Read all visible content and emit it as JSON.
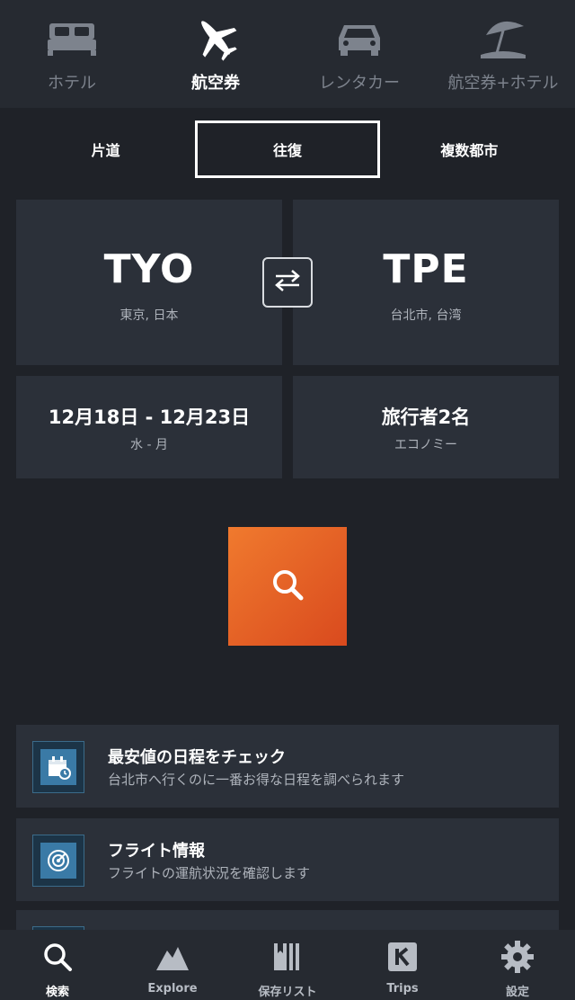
{
  "categories": [
    {
      "label": "ホテル",
      "icon": "bed-icon",
      "active": false
    },
    {
      "label": "航空券",
      "icon": "airplane-icon",
      "active": true
    },
    {
      "label": "レンタカー",
      "icon": "car-icon",
      "active": false
    },
    {
      "label": "航空券+ホテル",
      "icon": "beach-umbrella-icon",
      "active": false
    }
  ],
  "trip_types": [
    {
      "label": "片道",
      "active": false
    },
    {
      "label": "往復",
      "active": true
    },
    {
      "label": "複数都市",
      "active": false
    }
  ],
  "route": {
    "origin_code": "TYO",
    "origin_city": "東京, 日本",
    "dest_code": "TPE",
    "dest_city": "台北市, 台湾",
    "swap_icon": "swap-arrows-icon"
  },
  "dates": {
    "range": "12月18日 - 12月23日",
    "days": "水 - 月"
  },
  "travelers": {
    "count": "旅行者2名",
    "cabin": "エコノミー"
  },
  "search": {
    "icon": "search-icon"
  },
  "info_rows": [
    {
      "title": "最安値の日程をチェック",
      "desc": "台北市へ行くのに一番お得な日程を調べられます",
      "icon": "calendar-clock-icon"
    },
    {
      "title": "フライト情報",
      "desc": "フライトの運航状況を確認します",
      "icon": "radar-icon"
    }
  ],
  "bottom_nav": [
    {
      "label": "検索",
      "icon": "search-icon",
      "active": true
    },
    {
      "label": "Explore",
      "icon": "mountain-icon",
      "active": false
    },
    {
      "label": "保存リスト",
      "icon": "bookmark-list-icon",
      "active": false
    },
    {
      "label": "Trips",
      "icon": "kayak-k-icon",
      "active": false
    },
    {
      "label": "設定",
      "icon": "gear-icon",
      "active": false
    }
  ],
  "colors": {
    "background": "#1f2228",
    "card": "#2b3039",
    "accent_orange": "#ec6a2a",
    "inactive_text": "#7d838d"
  }
}
